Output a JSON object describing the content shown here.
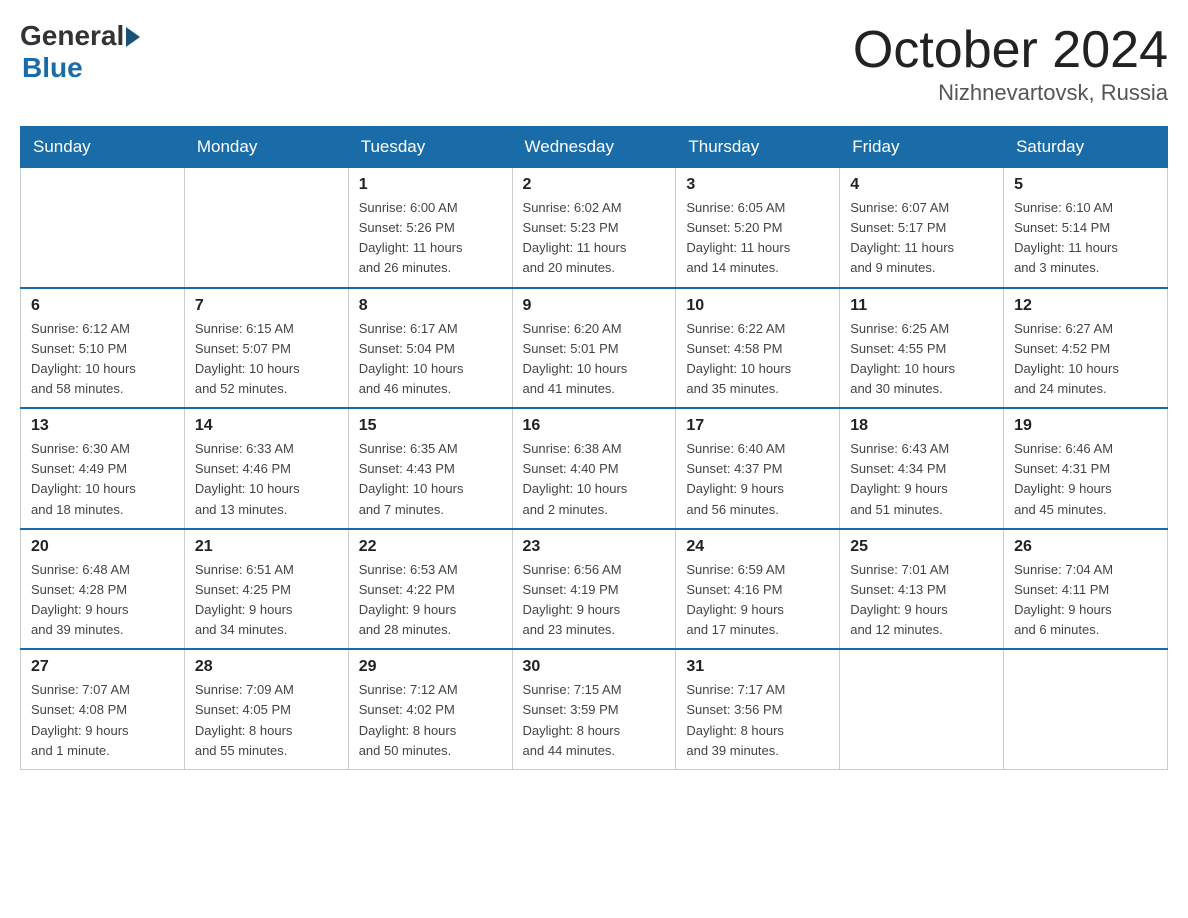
{
  "header": {
    "logo_general": "General",
    "logo_blue": "Blue",
    "month_title": "October 2024",
    "location": "Nizhnevartovsk, Russia"
  },
  "weekdays": [
    "Sunday",
    "Monday",
    "Tuesday",
    "Wednesday",
    "Thursday",
    "Friday",
    "Saturday"
  ],
  "weeks": [
    [
      {
        "day": "",
        "info": ""
      },
      {
        "day": "",
        "info": ""
      },
      {
        "day": "1",
        "info": "Sunrise: 6:00 AM\nSunset: 5:26 PM\nDaylight: 11 hours\nand 26 minutes."
      },
      {
        "day": "2",
        "info": "Sunrise: 6:02 AM\nSunset: 5:23 PM\nDaylight: 11 hours\nand 20 minutes."
      },
      {
        "day": "3",
        "info": "Sunrise: 6:05 AM\nSunset: 5:20 PM\nDaylight: 11 hours\nand 14 minutes."
      },
      {
        "day": "4",
        "info": "Sunrise: 6:07 AM\nSunset: 5:17 PM\nDaylight: 11 hours\nand 9 minutes."
      },
      {
        "day": "5",
        "info": "Sunrise: 6:10 AM\nSunset: 5:14 PM\nDaylight: 11 hours\nand 3 minutes."
      }
    ],
    [
      {
        "day": "6",
        "info": "Sunrise: 6:12 AM\nSunset: 5:10 PM\nDaylight: 10 hours\nand 58 minutes."
      },
      {
        "day": "7",
        "info": "Sunrise: 6:15 AM\nSunset: 5:07 PM\nDaylight: 10 hours\nand 52 minutes."
      },
      {
        "day": "8",
        "info": "Sunrise: 6:17 AM\nSunset: 5:04 PM\nDaylight: 10 hours\nand 46 minutes."
      },
      {
        "day": "9",
        "info": "Sunrise: 6:20 AM\nSunset: 5:01 PM\nDaylight: 10 hours\nand 41 minutes."
      },
      {
        "day": "10",
        "info": "Sunrise: 6:22 AM\nSunset: 4:58 PM\nDaylight: 10 hours\nand 35 minutes."
      },
      {
        "day": "11",
        "info": "Sunrise: 6:25 AM\nSunset: 4:55 PM\nDaylight: 10 hours\nand 30 minutes."
      },
      {
        "day": "12",
        "info": "Sunrise: 6:27 AM\nSunset: 4:52 PM\nDaylight: 10 hours\nand 24 minutes."
      }
    ],
    [
      {
        "day": "13",
        "info": "Sunrise: 6:30 AM\nSunset: 4:49 PM\nDaylight: 10 hours\nand 18 minutes."
      },
      {
        "day": "14",
        "info": "Sunrise: 6:33 AM\nSunset: 4:46 PM\nDaylight: 10 hours\nand 13 minutes."
      },
      {
        "day": "15",
        "info": "Sunrise: 6:35 AM\nSunset: 4:43 PM\nDaylight: 10 hours\nand 7 minutes."
      },
      {
        "day": "16",
        "info": "Sunrise: 6:38 AM\nSunset: 4:40 PM\nDaylight: 10 hours\nand 2 minutes."
      },
      {
        "day": "17",
        "info": "Sunrise: 6:40 AM\nSunset: 4:37 PM\nDaylight: 9 hours\nand 56 minutes."
      },
      {
        "day": "18",
        "info": "Sunrise: 6:43 AM\nSunset: 4:34 PM\nDaylight: 9 hours\nand 51 minutes."
      },
      {
        "day": "19",
        "info": "Sunrise: 6:46 AM\nSunset: 4:31 PM\nDaylight: 9 hours\nand 45 minutes."
      }
    ],
    [
      {
        "day": "20",
        "info": "Sunrise: 6:48 AM\nSunset: 4:28 PM\nDaylight: 9 hours\nand 39 minutes."
      },
      {
        "day": "21",
        "info": "Sunrise: 6:51 AM\nSunset: 4:25 PM\nDaylight: 9 hours\nand 34 minutes."
      },
      {
        "day": "22",
        "info": "Sunrise: 6:53 AM\nSunset: 4:22 PM\nDaylight: 9 hours\nand 28 minutes."
      },
      {
        "day": "23",
        "info": "Sunrise: 6:56 AM\nSunset: 4:19 PM\nDaylight: 9 hours\nand 23 minutes."
      },
      {
        "day": "24",
        "info": "Sunrise: 6:59 AM\nSunset: 4:16 PM\nDaylight: 9 hours\nand 17 minutes."
      },
      {
        "day": "25",
        "info": "Sunrise: 7:01 AM\nSunset: 4:13 PM\nDaylight: 9 hours\nand 12 minutes."
      },
      {
        "day": "26",
        "info": "Sunrise: 7:04 AM\nSunset: 4:11 PM\nDaylight: 9 hours\nand 6 minutes."
      }
    ],
    [
      {
        "day": "27",
        "info": "Sunrise: 7:07 AM\nSunset: 4:08 PM\nDaylight: 9 hours\nand 1 minute."
      },
      {
        "day": "28",
        "info": "Sunrise: 7:09 AM\nSunset: 4:05 PM\nDaylight: 8 hours\nand 55 minutes."
      },
      {
        "day": "29",
        "info": "Sunrise: 7:12 AM\nSunset: 4:02 PM\nDaylight: 8 hours\nand 50 minutes."
      },
      {
        "day": "30",
        "info": "Sunrise: 7:15 AM\nSunset: 3:59 PM\nDaylight: 8 hours\nand 44 minutes."
      },
      {
        "day": "31",
        "info": "Sunrise: 7:17 AM\nSunset: 3:56 PM\nDaylight: 8 hours\nand 39 minutes."
      },
      {
        "day": "",
        "info": ""
      },
      {
        "day": "",
        "info": ""
      }
    ]
  ]
}
